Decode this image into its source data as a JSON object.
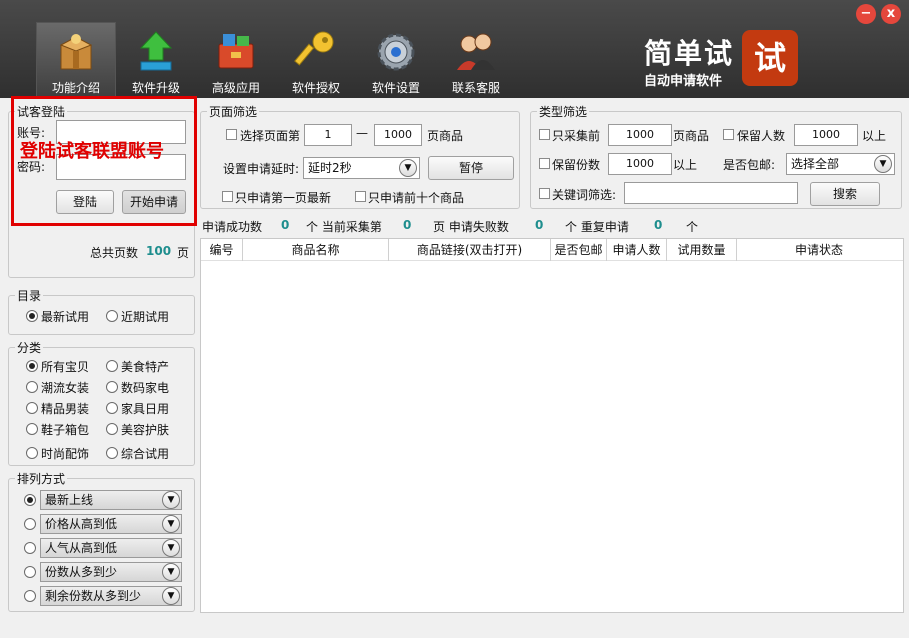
{
  "toolbar": {
    "items": [
      {
        "label": "功能介绍",
        "icon": "box-icon",
        "active": true
      },
      {
        "label": "软件升级",
        "icon": "upload-arrow-icon"
      },
      {
        "label": "高级应用",
        "icon": "toolbox-icon"
      },
      {
        "label": "软件授权",
        "icon": "key-icon"
      },
      {
        "label": "软件设置",
        "icon": "gear-icon"
      },
      {
        "label": "联系客服",
        "icon": "support-people-icon"
      }
    ],
    "minimize": "−",
    "close": "x"
  },
  "brand": {
    "title": "简单试",
    "subtitle": "自动申请软件",
    "logo_char": "试",
    "logo_color": "#c33a10"
  },
  "login": {
    "legend": "试客登陆",
    "account_label": "账号:",
    "password_label": "密码:",
    "account_value": "",
    "password_value": "",
    "login_button": "登陆",
    "start_button": "开始申请",
    "annotation": "登陆试客联盟账号",
    "total_pages_label": "总共页数",
    "total_pages_value": "100",
    "total_pages_unit": "页"
  },
  "catalog": {
    "legend": "目录",
    "options": [
      {
        "label": "最新试用",
        "selected": true
      },
      {
        "label": "近期试用",
        "selected": false
      }
    ]
  },
  "category": {
    "legend": "分类",
    "options": [
      {
        "label": "所有宝贝",
        "selected": true
      },
      {
        "label": "美食特产"
      },
      {
        "label": "潮流女装"
      },
      {
        "label": "数码家电"
      },
      {
        "label": "精品男装"
      },
      {
        "label": "家具日用"
      },
      {
        "label": "鞋子箱包"
      },
      {
        "label": "美容护肤"
      },
      {
        "label": "时尚配饰"
      },
      {
        "label": "综合试用"
      }
    ]
  },
  "sort": {
    "legend": "排列方式",
    "options": [
      {
        "label": "最新上线",
        "selected": true
      },
      {
        "label": "价格从高到低"
      },
      {
        "label": "人气从高到低"
      },
      {
        "label": "份数从多到少"
      },
      {
        "label": "剩余份数从多到少"
      }
    ]
  },
  "page_filter": {
    "legend": "页面筛选",
    "select_pages_label": "选择页面第",
    "page_from": "1",
    "dash": "—",
    "page_to": "1000",
    "page_suffix": "页商品",
    "delay_label": "设置申请延时:",
    "delay_value": "延时2秒",
    "pause_button": "暂停",
    "first_page_only": "只申请第一页最新",
    "first_ten_only": "只申请前十个商品"
  },
  "type_filter": {
    "legend": "类型筛选",
    "collect_first_label": "只采集前",
    "collect_first_value": "1000",
    "collect_first_suffix": "页商品",
    "keep_people_label": "保留人数",
    "keep_people_value": "1000",
    "keep_people_suffix": "以上",
    "keep_count_label": "保留份数",
    "keep_count_value": "1000",
    "keep_count_suffix": "以上",
    "free_ship_label": "是否包邮:",
    "free_ship_value": "选择全部",
    "keyword_label": "关键词筛选:",
    "keyword_value": "",
    "search_button": "搜索"
  },
  "status": {
    "success_label": "申请成功数",
    "success_value": "0",
    "current_label": "个 当前采集第",
    "current_value": "0",
    "fail_label": "页 申请失败数",
    "fail_value": "0",
    "repeat_label": "个 重复申请",
    "repeat_value": "0",
    "repeat_unit": "个"
  },
  "table": {
    "columns": [
      "编号",
      "商品名称",
      "商品链接(双击打开)",
      "是否包邮",
      "申请人数",
      "试用数量",
      "申请状态"
    ],
    "rows": []
  }
}
